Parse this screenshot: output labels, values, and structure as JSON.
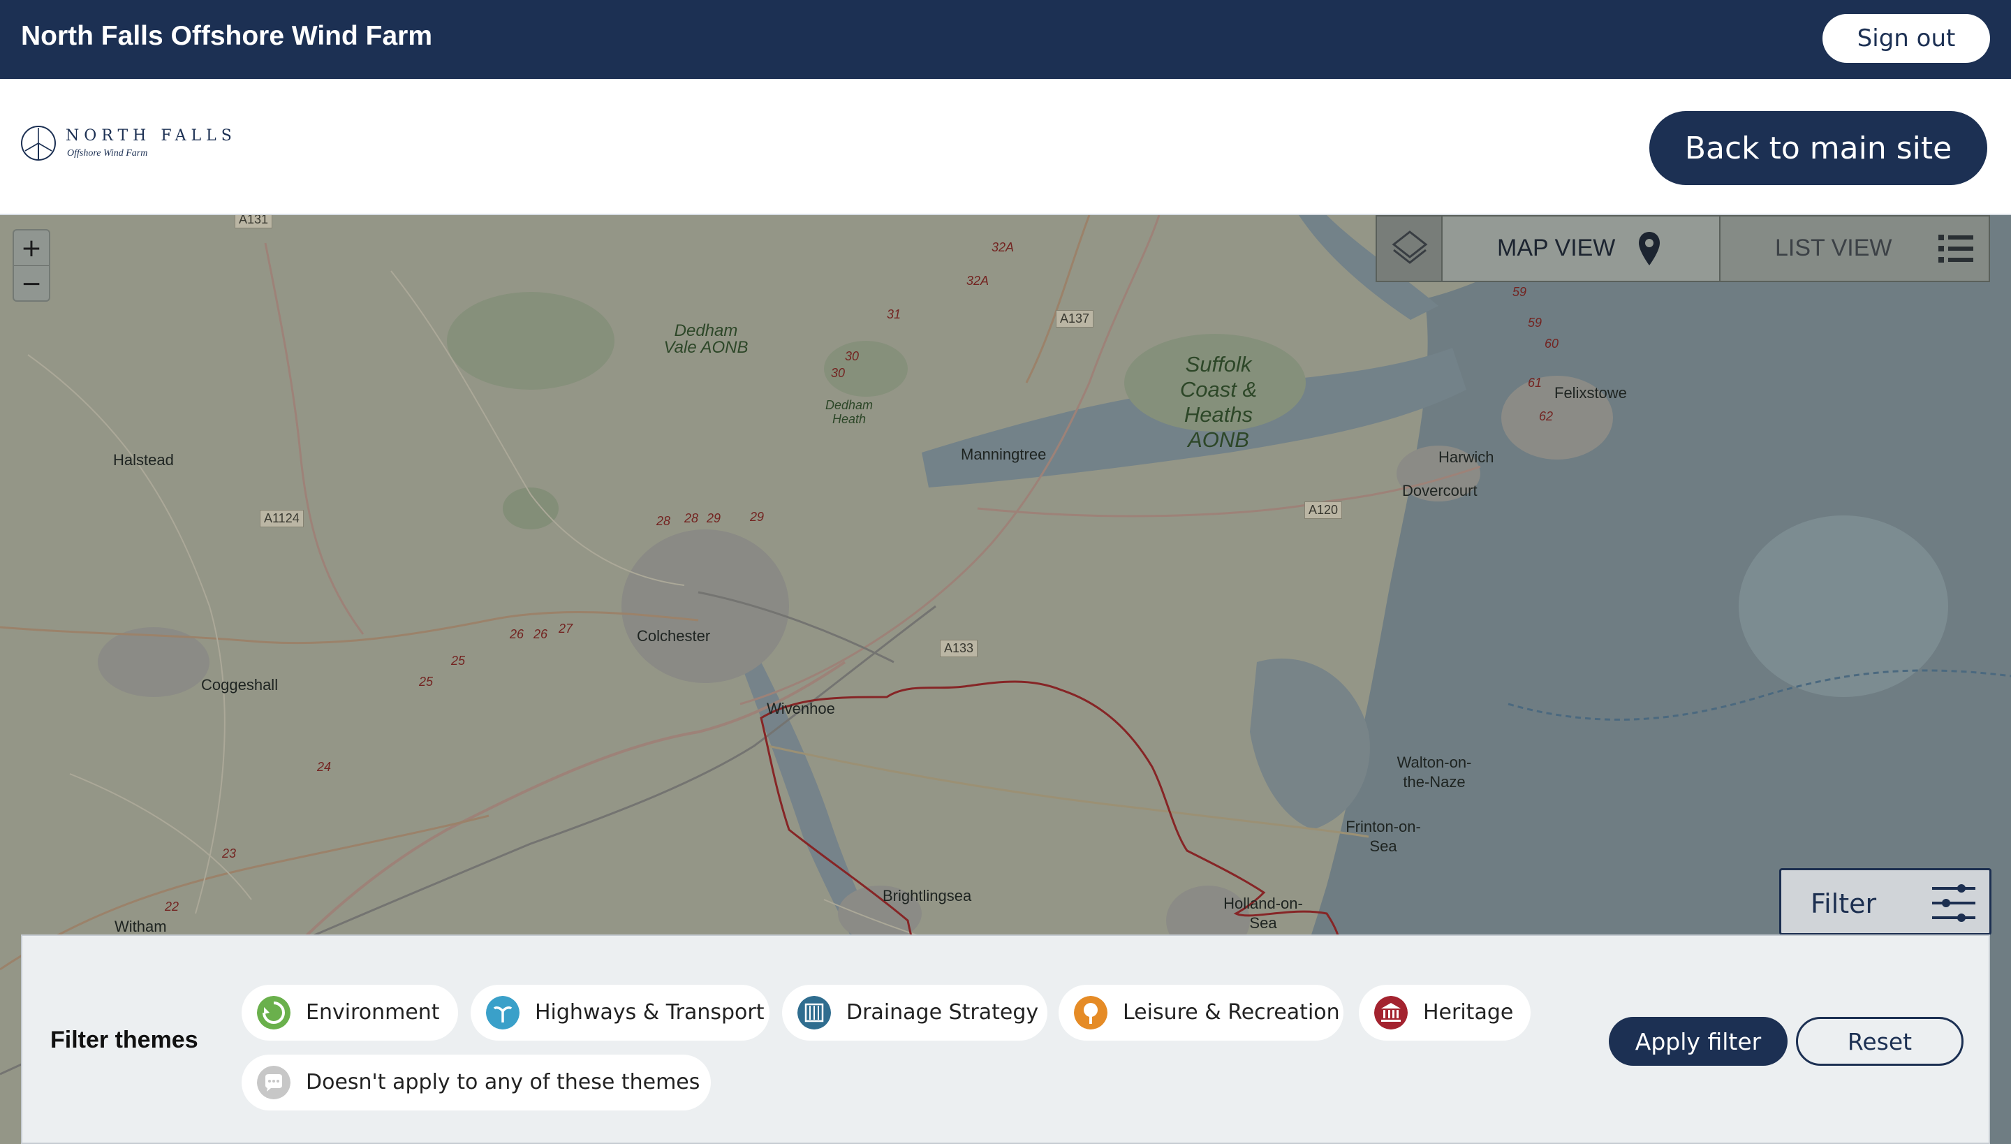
{
  "topbar": {
    "title": "North Falls Offshore Wind Farm",
    "sign_out": "Sign out"
  },
  "header": {
    "logo": {
      "name": "NORTH FALLS",
      "subtitle": "Offshore Wind Farm",
      "icon": "turbine-logo-icon"
    },
    "back_button": "Back to main site"
  },
  "map": {
    "zoom_in": "+",
    "zoom_out": "−",
    "layers_icon": "layers-icon",
    "map_view": {
      "label": "MAP VIEW",
      "icon": "map-pin-icon"
    },
    "list_view": {
      "label": "LIST VIEW",
      "icon": "list-icon"
    },
    "places": [
      "Halstead",
      "Coggeshall",
      "Witham",
      "Colchester",
      "Wivenhoe",
      "Manningtree",
      "Brightlingsea",
      "Harwich",
      "Dovercourt",
      "Felixstowe",
      "Walton-on-the-Naze",
      "Frinton-on-Sea",
      "Holland-on-Sea"
    ],
    "aonb": [
      "Dedham Vale AONB",
      "Dedham Heath",
      "Suffolk Coast & Heaths AONB"
    ],
    "roads": [
      "A131",
      "A137",
      "A1124",
      "A120",
      "A133"
    ],
    "junctions": [
      "32A",
      "32A",
      "31",
      "30",
      "30",
      "28",
      "28",
      "29",
      "29",
      "26",
      "26",
      "27",
      "25",
      "25",
      "24",
      "23",
      "22",
      "59",
      "59",
      "60",
      "61",
      "62"
    ],
    "filter_button": {
      "label": "Filter",
      "icon": "sliders-icon"
    }
  },
  "filter_panel": {
    "title": "Filter themes",
    "themes": [
      {
        "label": "Environment",
        "icon": "environment-icon",
        "color": "#6ab04c"
      },
      {
        "label": "Highways & Transport",
        "icon": "transport-icon",
        "color": "#3aa0c9"
      },
      {
        "label": "Drainage Strategy",
        "icon": "drainage-icon",
        "color": "#2f6d8f"
      },
      {
        "label": "Leisure & Recreation",
        "icon": "leisure-icon",
        "color": "#e58b26"
      },
      {
        "label": "Heritage",
        "icon": "heritage-icon",
        "color": "#a3232f"
      },
      {
        "label": "Doesn't apply to any of these themes",
        "icon": "chat-icon",
        "color": "#c7c7c7"
      }
    ],
    "apply": "Apply filter",
    "reset": "Reset"
  },
  "colors": {
    "brand": "#1c3053",
    "panel": "#eceff1",
    "boundary": "#b22c2c"
  }
}
